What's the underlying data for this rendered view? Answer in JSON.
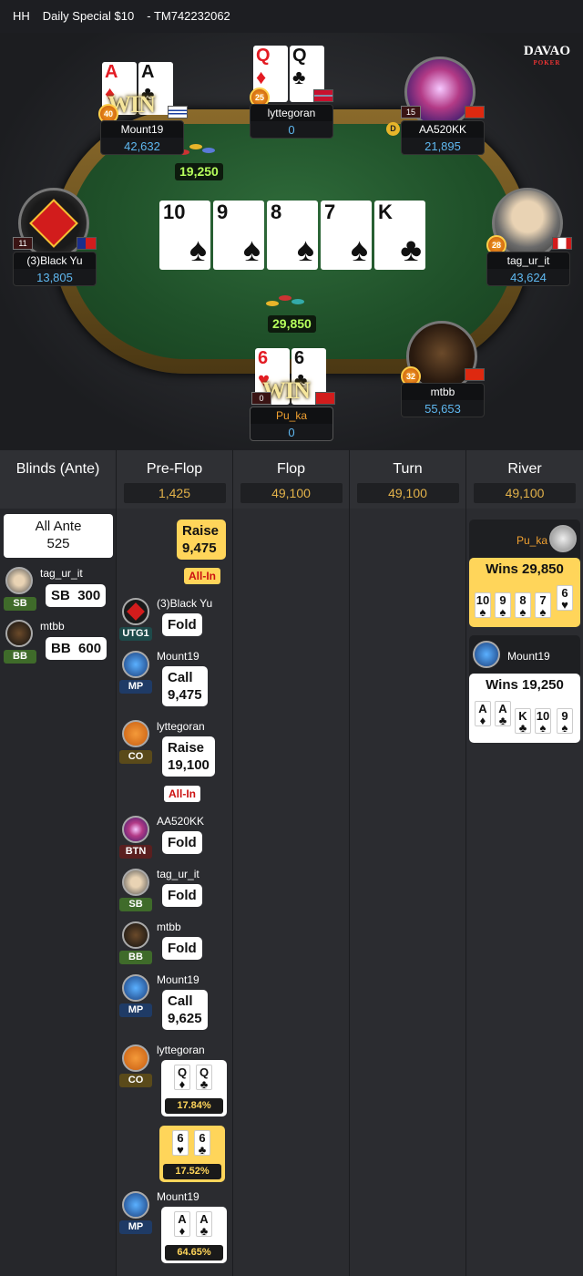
{
  "header": {
    "hh": "HH",
    "title": "Daily Special $10",
    "hand_id": "- TM742232062"
  },
  "logo": {
    "brand": "DAVAO",
    "sub": "POKER"
  },
  "board": [
    {
      "rank": "10",
      "suit": "♠",
      "color": "#111"
    },
    {
      "rank": "9",
      "suit": "♠",
      "color": "#111"
    },
    {
      "rank": "8",
      "suit": "♠",
      "color": "#111"
    },
    {
      "rank": "7",
      "suit": "♠",
      "color": "#111"
    },
    {
      "rank": "K",
      "suit": "♣",
      "color": "#111"
    }
  ],
  "pots": {
    "side": "19,250",
    "main": "29,850"
  },
  "win_text": "WIN",
  "dealer": "D",
  "seats": {
    "mount19": {
      "name": "Mount19",
      "stack": "42,632",
      "level": "40",
      "cards": [
        {
          "rank": "A",
          "suit": "♦"
        },
        {
          "rank": "A",
          "suit": "♣"
        }
      ]
    },
    "lyttegoran": {
      "name": "lyttegoran",
      "stack": "0",
      "level": "25",
      "cards": [
        {
          "rank": "Q",
          "suit": "♦"
        },
        {
          "rank": "Q",
          "suit": "♣"
        }
      ]
    },
    "aa520kk": {
      "name": "AA520KK",
      "stack": "21,895",
      "level": "15"
    },
    "blackyu": {
      "name": "(3)Black Yu",
      "stack": "13,805",
      "level": "11"
    },
    "tagurit": {
      "name": "tag_ur_it",
      "stack": "43,624",
      "level": "28"
    },
    "mtbb": {
      "name": "mtbb",
      "stack": "55,653",
      "level": "32"
    },
    "puka": {
      "name": "Pu_ka",
      "stack": "0",
      "level": "0",
      "cards": [
        {
          "rank": "6",
          "suit": "♥"
        },
        {
          "rank": "6",
          "suit": "♣"
        }
      ]
    }
  },
  "history": {
    "columns": [
      {
        "title": "Blinds (Ante)",
        "value": ""
      },
      {
        "title": "Pre-Flop",
        "value": "1,425"
      },
      {
        "title": "Flop",
        "value": "49,100"
      },
      {
        "title": "Turn",
        "value": "49,100"
      },
      {
        "title": "River",
        "value": "49,100"
      }
    ],
    "ante": {
      "label": "All Ante",
      "value": "525"
    },
    "blinds": [
      {
        "name": "tag_ur_it",
        "pos": "SB",
        "action": "SB",
        "amount": "300"
      },
      {
        "name": "mtbb",
        "pos": "BB",
        "action": "BB",
        "amount": "600"
      }
    ],
    "preflop": {
      "first_raise": {
        "action": "Raise",
        "amount": "9,475",
        "allin": "All-In"
      },
      "actions": [
        {
          "name": "(3)Black Yu",
          "pos": "UTG1",
          "action": "Fold",
          "amount": ""
        },
        {
          "name": "Mount19",
          "pos": "MP",
          "action": "Call",
          "amount": "9,475"
        },
        {
          "name": "lyttegoran",
          "pos": "CO",
          "action": "Raise",
          "amount": "19,100",
          "allin": "All-In"
        },
        {
          "name": "AA520KK",
          "pos": "BTN",
          "action": "Fold",
          "amount": ""
        },
        {
          "name": "tag_ur_it",
          "pos": "SB",
          "action": "Fold",
          "amount": ""
        },
        {
          "name": "mtbb",
          "pos": "BB",
          "action": "Fold",
          "amount": ""
        },
        {
          "name": "Mount19",
          "pos": "MP",
          "action": "Call",
          "amount": "9,625"
        }
      ],
      "showdown": [
        {
          "name": "lyttegoran",
          "pos": "CO",
          "cards": [
            {
              "rank": "Q",
              "suit": "♦"
            },
            {
              "rank": "Q",
              "suit": "♣"
            }
          ],
          "equity": "17.84%"
        },
        {
          "name": "",
          "pos": "",
          "cards": [
            {
              "rank": "6",
              "suit": "♥"
            },
            {
              "rank": "6",
              "suit": "♣"
            }
          ],
          "equity": "17.52%"
        },
        {
          "name": "Mount19",
          "pos": "MP",
          "cards": [
            {
              "rank": "A",
              "suit": "♦"
            },
            {
              "rank": "A",
              "suit": "♣"
            }
          ],
          "equity": "64.65%"
        }
      ]
    },
    "river": [
      {
        "name": "Pu_ka",
        "wins": "Wins 29,850",
        "cards": [
          {
            "rank": "10",
            "suit": "♠"
          },
          {
            "rank": "9",
            "suit": "♠"
          },
          {
            "rank": "8",
            "suit": "♠"
          },
          {
            "rank": "7",
            "suit": "♠"
          },
          {
            "rank": "6",
            "suit": "♥"
          }
        ]
      },
      {
        "name": "Mount19",
        "wins": "Wins 19,250",
        "cards": [
          {
            "rank": "A",
            "suit": "♦"
          },
          {
            "rank": "A",
            "suit": "♣"
          },
          {
            "rank": "K",
            "suit": "♣"
          },
          {
            "rank": "10",
            "suit": "♠"
          },
          {
            "rank": "9",
            "suit": "♠"
          }
        ]
      }
    ]
  },
  "colors": {
    "pos_sb": "#3f6b2a",
    "pos_bb": "#3f6b2a",
    "pos_mp": "#1f3b66",
    "pos_co": "#5a4a1a",
    "pos_btn": "#5a1f1f",
    "pos_utg1": "#1e4a4a",
    "accent": "#e3b24a"
  }
}
